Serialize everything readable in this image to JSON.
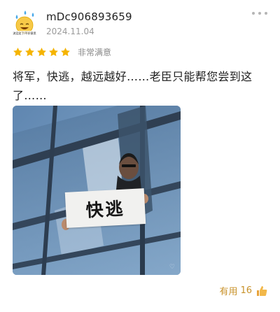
{
  "review": {
    "username": "mDc906893659",
    "date": "2024.11.04",
    "rating": {
      "stars": 5,
      "max": 5,
      "label": "非常满意"
    },
    "text": "将军，快逃，越远越好……老臣只能帮您尝到这了……",
    "photo": {
      "icon": "photo-meme",
      "sign_text": "快逃",
      "avatar_caption": "流泪笑了/不好意思"
    },
    "helpful": {
      "label": "有用",
      "count": "16",
      "icon": "thumbs-up-icon"
    }
  },
  "colors": {
    "star": "#f5b400",
    "helpful": "#c8922a",
    "muted": "#9a9a9a"
  }
}
